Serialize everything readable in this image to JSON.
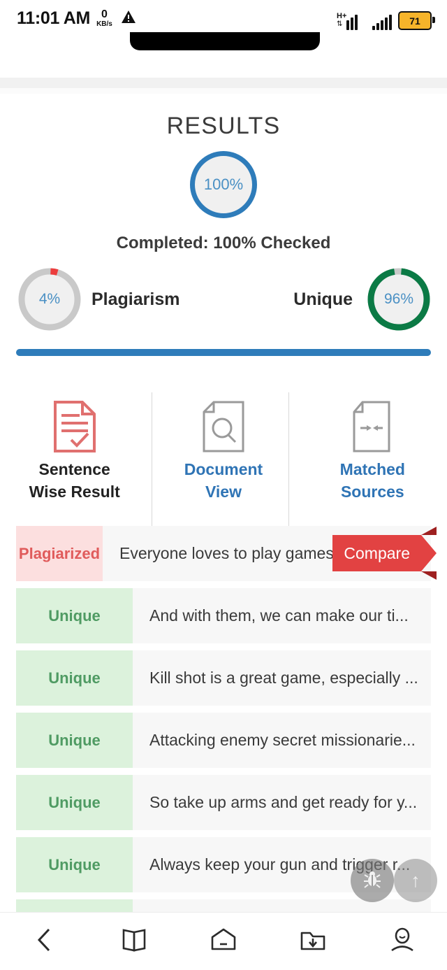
{
  "status_bar": {
    "time": "11:01 AM",
    "network_speed_value": "0",
    "network_speed_unit": "KB/s",
    "warning_icon": "warning-triangle-icon",
    "signal_type": "H+",
    "battery_percent": "71"
  },
  "results": {
    "title": "RESULTS",
    "progress_percent": "100%",
    "completed_text": "Completed: 100% Checked",
    "plagiarism": {
      "value": "4%",
      "label": "Plagiarism",
      "percent": 4,
      "color": "#ec3d3d",
      "track_color": "#c9c9c9"
    },
    "unique": {
      "value": "96%",
      "label": "Unique",
      "percent": 96,
      "color": "#0b7a45",
      "track_color": "#c9c9c9"
    },
    "accent_color": "#2e7cba"
  },
  "tabs": [
    {
      "label_line1": "Sentence",
      "label_line2": "Wise Result",
      "icon": "document-check-icon",
      "active": true,
      "icon_color": "#e0706f"
    },
    {
      "label_line1": "Document",
      "label_line2": "View",
      "icon": "document-search-icon",
      "active": false,
      "icon_color": "#9a9a9a"
    },
    {
      "label_line1": "Matched",
      "label_line2": "Sources",
      "icon": "document-compare-icon",
      "active": false,
      "icon_color": "#9a9a9a"
    }
  ],
  "sentences": [
    {
      "status": "Plagiarized",
      "text": "Everyone loves to play games, ...",
      "action": "Compare"
    },
    {
      "status": "Unique",
      "text": "And with them, we can make our ti..."
    },
    {
      "status": "Unique",
      "text": "Kill shot is a great game, especially ..."
    },
    {
      "status": "Unique",
      "text": "Attacking enemy secret missionarie..."
    },
    {
      "status": "Unique",
      "text": "So take up arms and get ready for y..."
    },
    {
      "status": "Unique",
      "text": "Always keep your gun and trigger r..."
    }
  ],
  "floating_buttons": [
    {
      "name": "bug-report-button",
      "icon": "bug-icon"
    },
    {
      "name": "scroll-to-top-button",
      "icon": "arrow-up-icon",
      "glyph": "↑"
    }
  ],
  "bottom_nav": [
    {
      "name": "back-button",
      "icon": "chevron-left-icon"
    },
    {
      "name": "bookmarks-button",
      "icon": "book-icon"
    },
    {
      "name": "home-button",
      "icon": "home-icon"
    },
    {
      "name": "downloads-button",
      "icon": "folder-download-icon"
    },
    {
      "name": "profile-button",
      "icon": "person-icon"
    }
  ]
}
